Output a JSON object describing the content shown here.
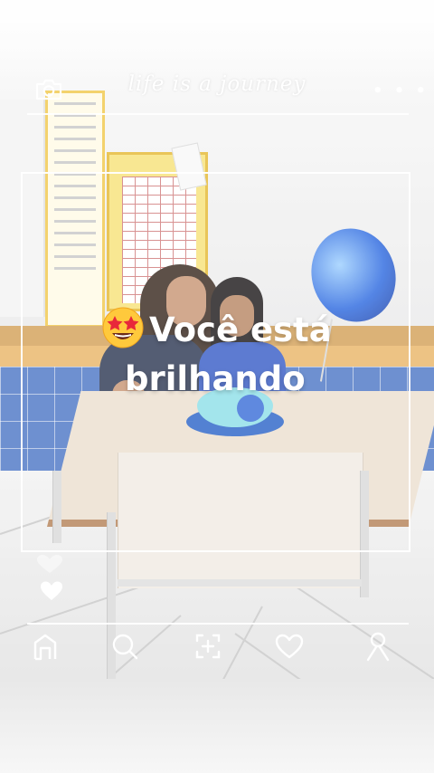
{
  "header": {
    "title": "life is a journey"
  },
  "overlay": {
    "caption_line1": "Você está",
    "caption_line2": "brilhando",
    "caption_emoji": "star-struck-emoji"
  },
  "icons": {
    "top_left": "camera-icon",
    "top_right": "more-options-icon",
    "left_side": "heart-icon"
  },
  "bottom_nav": {
    "items": [
      {
        "id": "home",
        "icon": "home-icon"
      },
      {
        "id": "search",
        "icon": "search-icon"
      },
      {
        "id": "add",
        "icon": "add-square-icon"
      },
      {
        "id": "likes",
        "icon": "heart-icon"
      },
      {
        "id": "profile",
        "icon": "profile-icon"
      }
    ]
  },
  "colors": {
    "overlay_ui": "#ffffff",
    "balloon": "#2f6be0",
    "wall_tiles": "#4f78c6",
    "tile_stripe": "#d4a25a"
  }
}
